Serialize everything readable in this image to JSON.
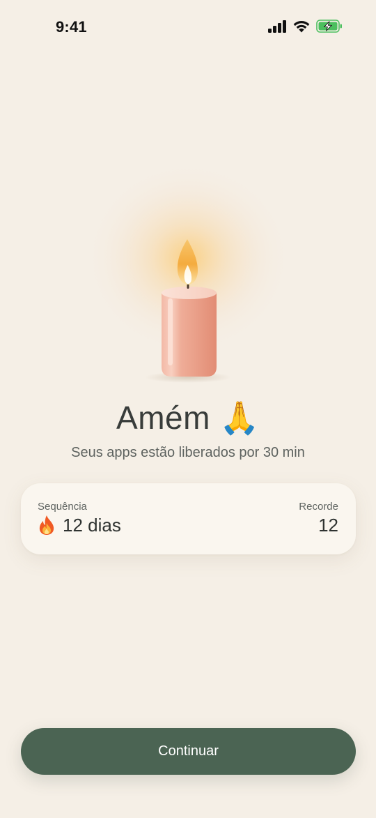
{
  "status_bar": {
    "time": "9:41",
    "icons": [
      "cellular-signal-icon",
      "wifi-icon",
      "battery-charging-icon"
    ]
  },
  "hero": {
    "illustration": "candle-icon",
    "title": "Amém 🙏",
    "subtitle": "Seus apps estão liberados por 30 min"
  },
  "stats": {
    "streak_label": "Sequência",
    "streak_icon": "fire-icon",
    "streak_value": "12 dias",
    "record_label": "Recorde",
    "record_value": "12"
  },
  "actions": {
    "continue_label": "Continuar"
  },
  "colors": {
    "background": "#f5efe6",
    "card": "#faf6ef",
    "button": "#4b6453",
    "candle": "#ea9e86",
    "flame": "#f6b445"
  }
}
